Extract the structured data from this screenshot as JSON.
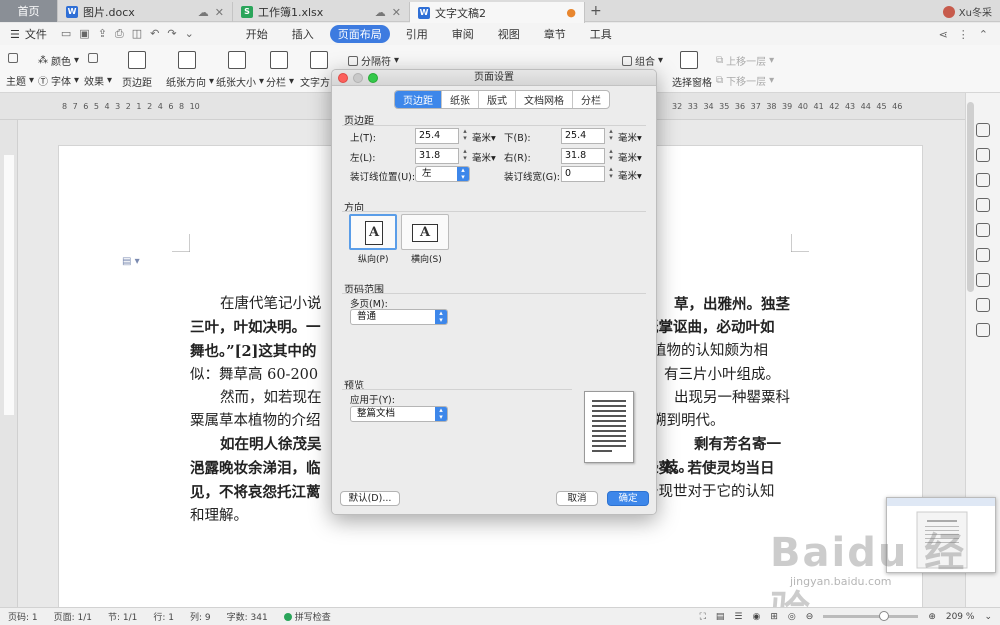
{
  "tabs": {
    "home": "首页",
    "doc1": "图片.docx",
    "xls": "工作簿1.xlsx",
    "doc2": "文字文稿2",
    "new": "+",
    "user": "Xu冬采"
  },
  "menu": {
    "file": "文件",
    "items": [
      "开始",
      "插入",
      "页面布局",
      "引用",
      "审阅",
      "视图",
      "章节",
      "工具"
    ],
    "active_index": 2
  },
  "ribbon": {
    "theme": "主题",
    "color": "颜色",
    "font": "字体",
    "effect": "效果",
    "margin": "页边距",
    "orientation": "纸张方向",
    "size": "纸张大小",
    "columns": "分栏",
    "textdir": "文字方向",
    "breaks": "分隔符",
    "group": "组合",
    "selpane": "选择窗格",
    "up": "上移一层",
    "down": "下移一层"
  },
  "ruler": {
    "left_nums": "8 7 6 5 4 3 2 1 2 4 6 8 10",
    "right_nums": "32 33 34 35 36 37 38 39 40 41 42 43 44 45 46"
  },
  "document": {
    "p1a": "在唐代笔记小说",
    "p1b": "草，出雅州。独茎",
    "p2a": "三叶，叶如决明。一",
    "p2b": "纸掌讴曲，必动叶如",
    "p3a": "舞也。”[2]这其中的",
    "p3b": "植物的认知颇为相",
    "p4a": "似：舞草高 60-200",
    "p4b": "有三片小叶组成。",
    "p5a": "然而，如若现在",
    "p5b": "出现另一种罌粟科罌",
    "p6a": "粟属草本植物的介绍",
    "p6b": "溯到明代。",
    "p7a": "如在明人徐茂吴",
    "p7b": "剩有芳名寄一枝。",
    "p8a": "浥露晚妆余涕泪，临",
    "p8b": "绿葵。若使灵均当日",
    "p9a": "见，不将哀怨托江蓠",
    "p9b": "于现世对于它的认知",
    "p10": "和理解。"
  },
  "dialog": {
    "title": "页面设置",
    "tabs": [
      "页边距",
      "纸张",
      "版式",
      "文档网格",
      "分栏"
    ],
    "active_tab": 0,
    "margins_title": "页边距",
    "top_label": "上(T):",
    "top_value": "25.4",
    "bottom_label": "下(B):",
    "bottom_value": "25.4",
    "left_label": "左(L):",
    "left_value": "31.8",
    "right_label": "右(R):",
    "right_value": "31.8",
    "gutter_pos_label": "装订线位置(U):",
    "gutter_pos_value": "左",
    "gutter_width_label": "装订线宽(G):",
    "gutter_width_value": "0",
    "unit": "毫米",
    "orientation_title": "方向",
    "portrait": "纵向(P)",
    "landscape": "横向(S)",
    "page_range_title": "页码范围",
    "multi_label": "多页(M):",
    "multi_value": "普通",
    "preview_title": "预览",
    "apply_label": "应用于(Y):",
    "apply_value": "整篇文档",
    "default_btn": "默认(D)...",
    "cancel_btn": "取消",
    "ok_btn": "确定"
  },
  "status": {
    "page": "页码: 1",
    "pages": "页面: 1/1",
    "section": "节: 1/1",
    "row": "行: 1",
    "col": "列: 9",
    "words": "字数: 341",
    "spell": "拼写检查",
    "zoom": "209 %"
  },
  "watermark": {
    "brand": "Baidu 经验",
    "url": "jingyan.baidu.com"
  }
}
